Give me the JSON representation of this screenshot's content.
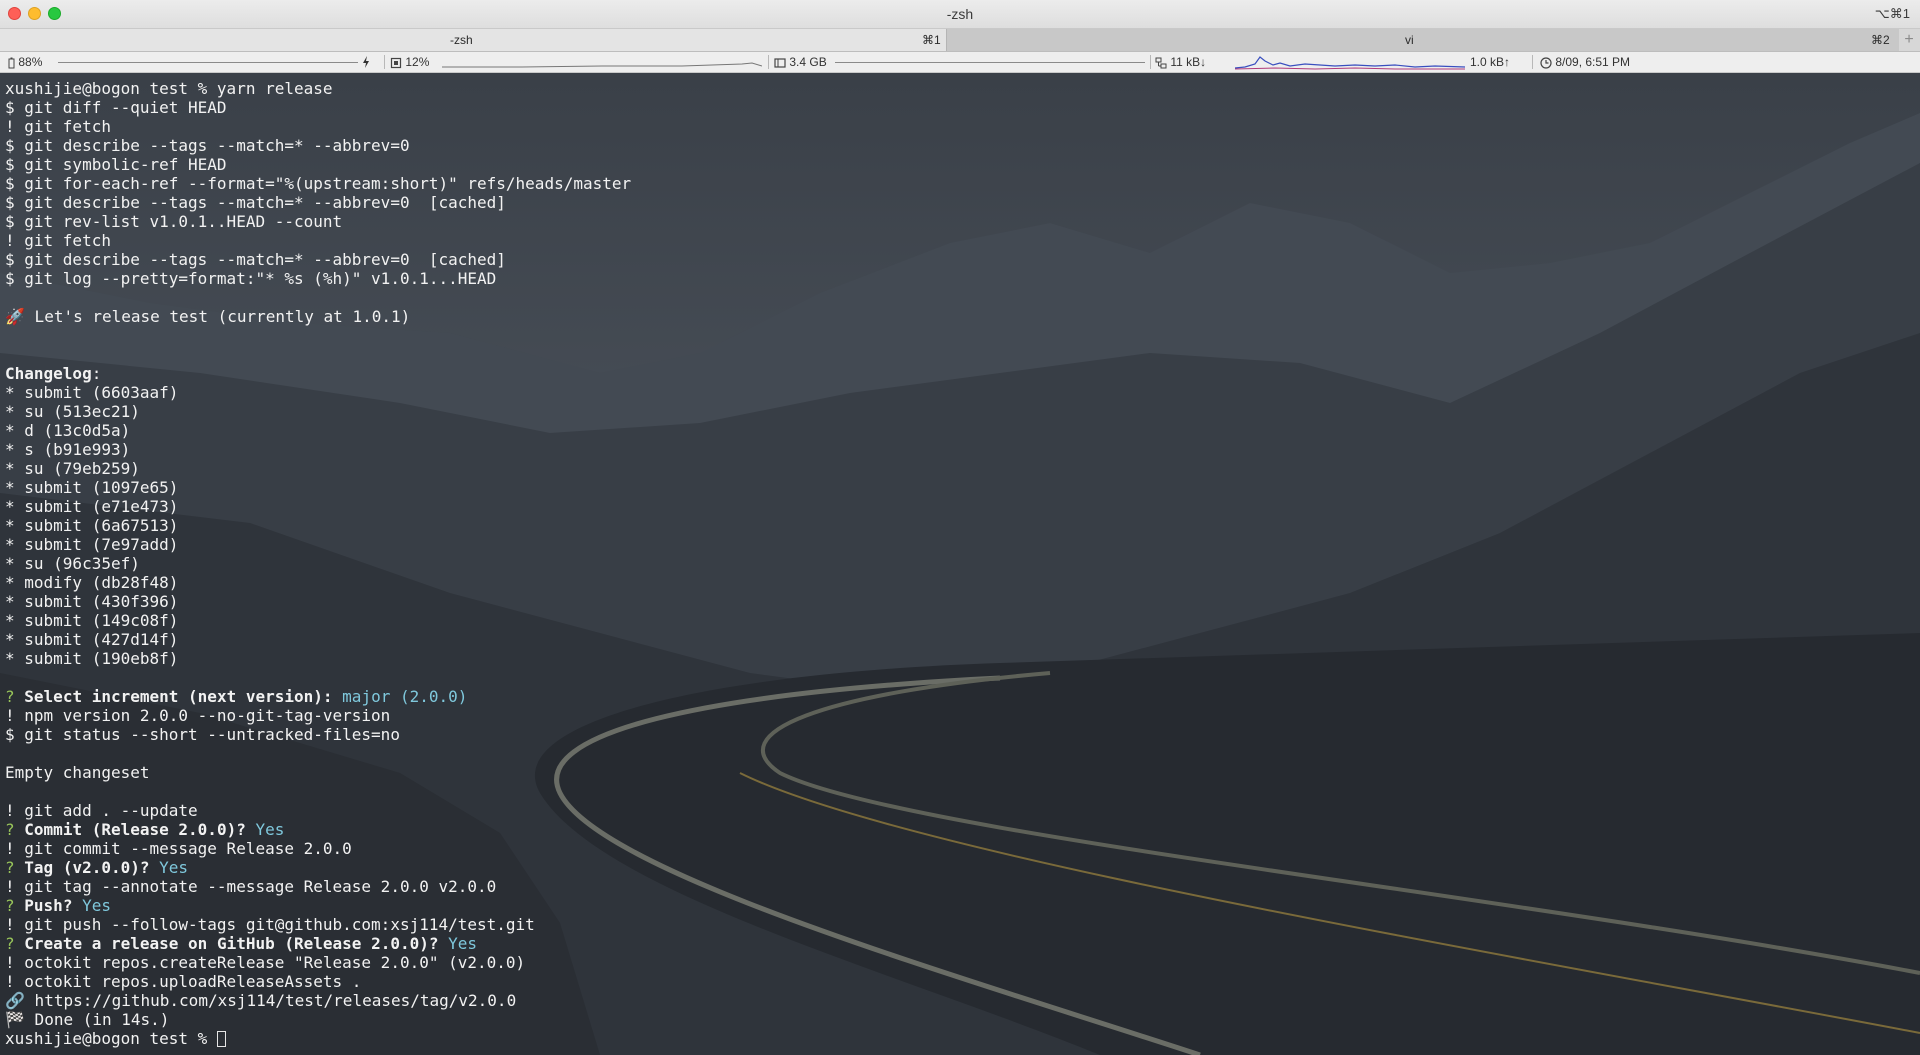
{
  "window": {
    "title": "-zsh",
    "shortcut": "⌥⌘1"
  },
  "tabs": [
    {
      "label": "-zsh",
      "shortcut": "⌘1"
    },
    {
      "label": "vi",
      "shortcut": "⌘2"
    }
  ],
  "tab_add": "+",
  "status": {
    "battery": "88%",
    "cpu": "12%",
    "memory": "3.4 GB",
    "net_down": "11 kB↓",
    "net_up": "1.0 kB↑",
    "clock": "8/09, 6:51 PM"
  },
  "colors": {
    "question_mark": "#98c45a",
    "answer": "#7fc8dc",
    "text": "#f2f2f2"
  },
  "terminal": {
    "l01": "xushijie@bogon test % yarn release",
    "l02": "$ git diff --quiet HEAD",
    "l03": "! git fetch",
    "l04": "$ git describe --tags --match=* --abbrev=0",
    "l05": "$ git symbolic-ref HEAD",
    "l06": "$ git for-each-ref --format=\"%(upstream:short)\" refs/heads/master",
    "l07": "$ git describe --tags --match=* --abbrev=0  [cached]",
    "l08": "$ git rev-list v1.0.1..HEAD --count",
    "l09": "! git fetch",
    "l10": "$ git describe --tags --match=* --abbrev=0  [cached]",
    "l11": "$ git log --pretty=format:\"* %s (%h)\" v1.0.1...HEAD",
    "l13": "🚀 Let's release test (currently at 1.0.1)",
    "changelog_label": "Changelog",
    "changelog_colon": ":",
    "changelog": [
      "* submit (6603aaf)",
      "* su (513ec21)",
      "* d (13c0d5a)",
      "* s (b91e993)",
      "* su (79eb259)",
      "* submit (1097e65)",
      "* submit (e71e473)",
      "* submit (6a67513)",
      "* submit (7e97add)",
      "* su (96c35ef)",
      "* modify (db28f48)",
      "* submit (430f396)",
      "* submit (149c08f)",
      "* submit (427d14f)",
      "* submit (190eb8f)"
    ],
    "q_mark": "?",
    "q_increment": "Select increment (next version):",
    "a_increment": "major (2.0.0)",
    "l_npm": "! npm version 2.0.0 --no-git-tag-version",
    "l_status": "$ git status --short --untracked-files=no",
    "l_empty": "Empty changeset",
    "l_add": "! git add . --update",
    "q_commit": "Commit (Release 2.0.0)?",
    "a_yes": "Yes",
    "l_commit": "! git commit --message Release 2.0.0",
    "q_tag": "Tag (v2.0.0)?",
    "l_tag": "! git tag --annotate --message Release 2.0.0 v2.0.0",
    "q_push": "Push?",
    "l_push": "! git push --follow-tags git@github.com:xsj114/test.git",
    "q_release": "Create a release on GitHub (Release 2.0.0)?",
    "l_create": "! octokit repos.createRelease \"Release 2.0.0\" (v2.0.0)",
    "l_upload": "! octokit repos.uploadReleaseAssets .",
    "l_link": "🔗 https://github.com/xsj114/test/releases/tag/v2.0.0",
    "l_done": "🏁 Done (in 14s.)",
    "prompt": "xushijie@bogon test % "
  }
}
